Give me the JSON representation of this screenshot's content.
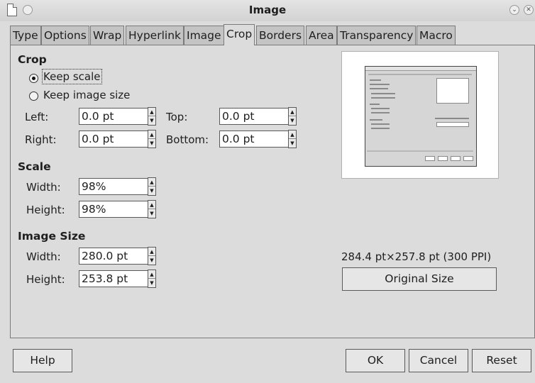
{
  "window": {
    "title": "Image"
  },
  "tabs": [
    "Type",
    "Options",
    "Wrap",
    "Hyperlink",
    "Image",
    "Crop",
    "Borders",
    "Area",
    "Transparency",
    "Macro"
  ],
  "active_tab": "Crop",
  "crop": {
    "section_title": "Crop",
    "keep_scale_label": "Keep scale",
    "keep_image_size_label": "Keep image size",
    "selected_option": "Keep scale",
    "left_label": "Left:",
    "left_value": "0.0 pt",
    "right_label": "Right:",
    "right_value": "0.0 pt",
    "top_label": "Top:",
    "top_value": "0.0 pt",
    "bottom_label": "Bottom:",
    "bottom_value": "0.0 pt"
  },
  "scale": {
    "section_title": "Scale",
    "width_label": "Width:",
    "width_value": "98%",
    "height_label": "Height:",
    "height_value": "98%"
  },
  "image_size": {
    "section_title": "Image Size",
    "width_label": "Width:",
    "width_value": "280.0 pt",
    "height_label": "Height:",
    "height_value": "253.8 pt"
  },
  "original": {
    "info": "284.4 pt×257.8 pt (300 PPI)",
    "button_label": "Original Size"
  },
  "buttons": {
    "help": "Help",
    "ok": "OK",
    "cancel": "Cancel",
    "reset": "Reset"
  }
}
